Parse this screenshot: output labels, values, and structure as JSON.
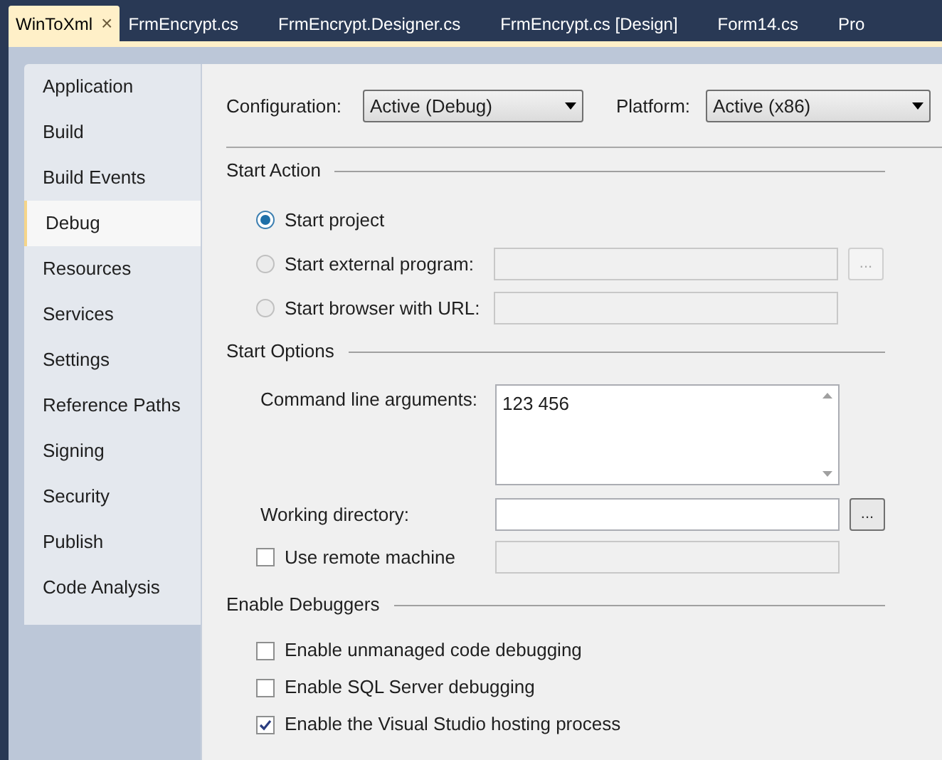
{
  "tabs": [
    {
      "label": "WinToXml",
      "selected": true,
      "close": "×"
    },
    {
      "label": "FrmEncrypt.cs",
      "selected": false
    },
    {
      "label": "FrmEncrypt.Designer.cs",
      "selected": false
    },
    {
      "label": "FrmEncrypt.cs [Design]",
      "selected": false
    },
    {
      "label": "Form14.cs",
      "selected": false
    },
    {
      "label": "Pro",
      "selected": false
    }
  ],
  "sidebar": {
    "items": [
      {
        "label": "Application",
        "selected": false
      },
      {
        "label": "Build",
        "selected": false
      },
      {
        "label": "Build Events",
        "selected": false
      },
      {
        "label": "Debug",
        "selected": true
      },
      {
        "label": "Resources",
        "selected": false
      },
      {
        "label": "Services",
        "selected": false
      },
      {
        "label": "Settings",
        "selected": false
      },
      {
        "label": "Reference Paths",
        "selected": false
      },
      {
        "label": "Signing",
        "selected": false
      },
      {
        "label": "Security",
        "selected": false
      },
      {
        "label": "Publish",
        "selected": false
      },
      {
        "label": "Code Analysis",
        "selected": false
      }
    ]
  },
  "configuration": {
    "label": "Configuration:",
    "value": "Active (Debug)"
  },
  "platform": {
    "label": "Platform:",
    "value": "Active (x86)"
  },
  "start_action": {
    "heading": "Start Action",
    "options": [
      {
        "label": "Start project",
        "selected": true
      },
      {
        "label": "Start external program:",
        "selected": false,
        "field": {
          "disabled": true
        },
        "browse": {
          "label": "...",
          "disabled": true
        }
      },
      {
        "label": "Start browser with URL:",
        "selected": false,
        "field": {
          "disabled": true
        }
      }
    ]
  },
  "start_options": {
    "heading": "Start Options",
    "command_line": {
      "label": "Command line arguments:",
      "value": "123 456"
    },
    "working_directory": {
      "label": "Working directory:",
      "disabled": false,
      "browse": {
        "label": "...",
        "disabled": false
      }
    },
    "remote_machine": {
      "label": "Use remote machine",
      "checked": false,
      "field": {
        "disabled": true
      }
    }
  },
  "enable_debuggers": {
    "heading": "Enable Debuggers",
    "options": [
      {
        "label": "Enable unmanaged code debugging",
        "checked": false
      },
      {
        "label": "Enable SQL Server debugging",
        "checked": false
      },
      {
        "label": "Enable the Visual Studio hosting process",
        "checked": true
      }
    ]
  }
}
